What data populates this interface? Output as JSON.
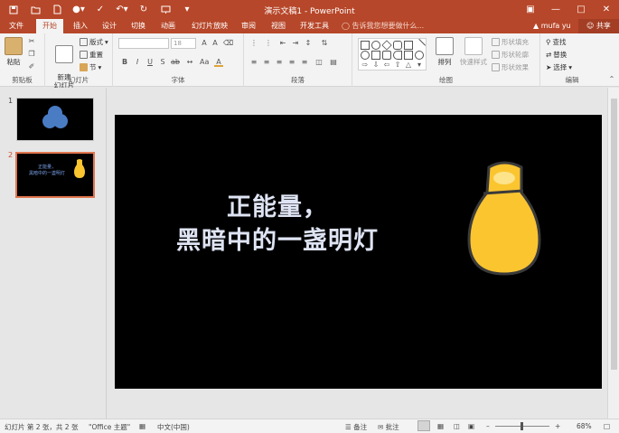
{
  "window": {
    "title": "演示文稿1 - PowerPoint"
  },
  "tabs": [
    "文件",
    "开始",
    "插入",
    "设计",
    "切换",
    "动画",
    "幻灯片放映",
    "审阅",
    "视图",
    "开发工具"
  ],
  "active_tab": "开始",
  "tell_me": "告诉我您想要做什么...",
  "user": "mufa yu",
  "share": "共享",
  "ribbon": {
    "clipboard": {
      "label": "剪贴板",
      "paste": "粘贴"
    },
    "slides": {
      "label": "幻灯片",
      "new_slide": "新建\n幻灯片",
      "layout": "版式",
      "reset": "重置",
      "section": "节"
    },
    "font": {
      "label": "字体",
      "size": "18"
    },
    "paragraph": {
      "label": "段落"
    },
    "drawing": {
      "label": "绘图",
      "arrange": "排列",
      "quick_styles": "快速样式",
      "fill": "形状填充",
      "outline": "形状轮廓",
      "effects": "形状效果"
    },
    "editing": {
      "label": "编辑",
      "find": "查找",
      "replace": "替换",
      "select": "选择"
    }
  },
  "thumbnails": [
    {
      "number": "1"
    },
    {
      "number": "2",
      "text_line1": "正能量，",
      "text_line2": "黑暗中的一盏明灯"
    }
  ],
  "slide": {
    "line1": "正能量，",
    "line2": "黑暗中的一盏明灯",
    "text_color": "#dfe4f4",
    "bulb_color": "#fbc530"
  },
  "status": {
    "slide_info": "幻灯片 第 2 张，共 2 张",
    "theme": "\"Office 主题\"",
    "language": "中文(中国)",
    "notes": "备注",
    "comments": "批注",
    "zoom": "68%"
  },
  "colors": {
    "accent": "#b7472a",
    "ribbon_bg": "#f3f3f3",
    "selection": "#e2764f"
  }
}
